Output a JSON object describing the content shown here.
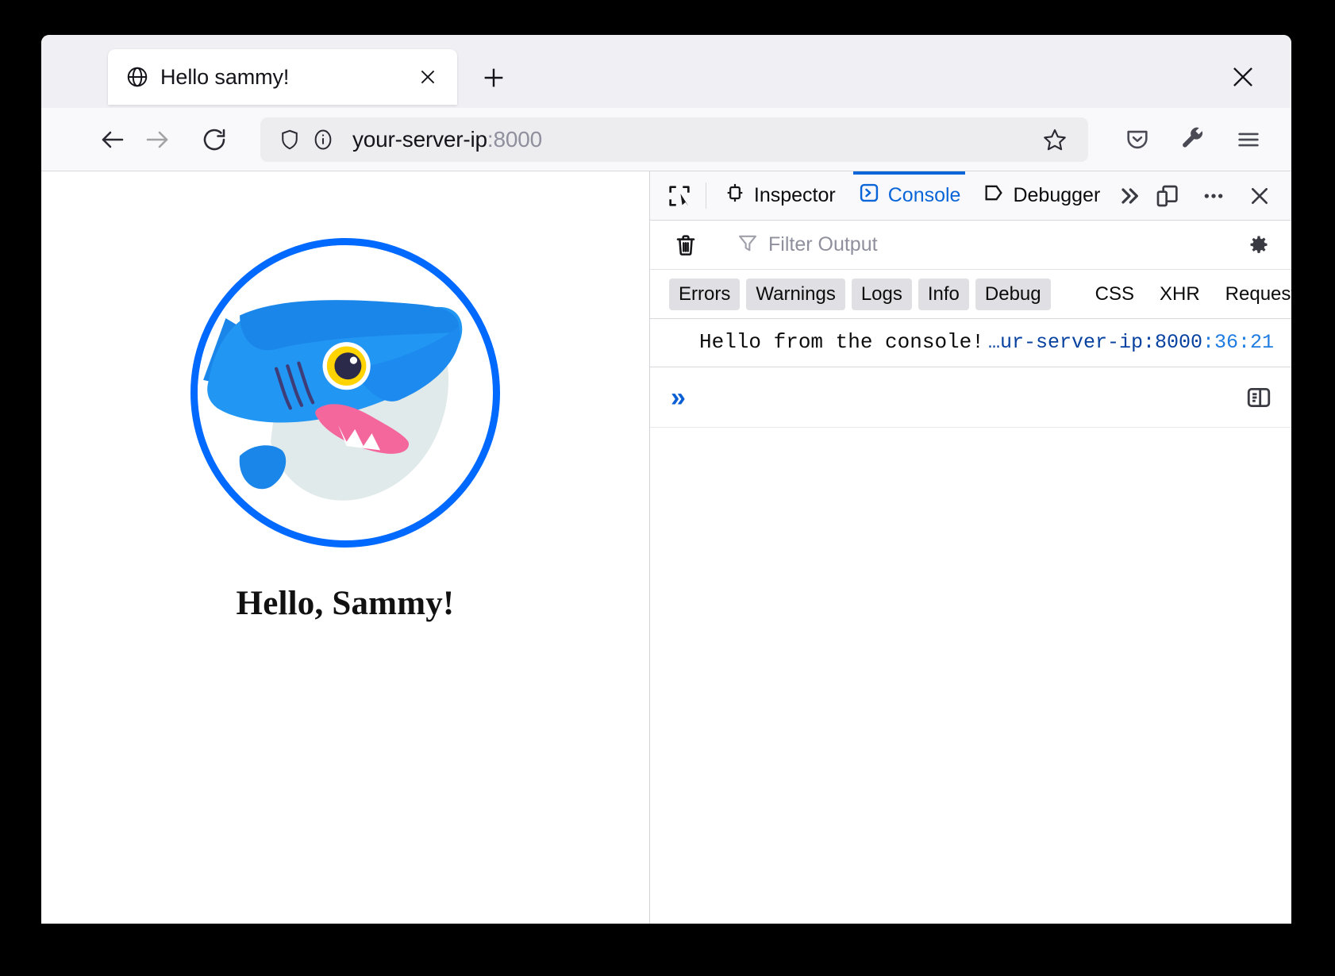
{
  "browser": {
    "tab": {
      "title": "Hello sammy!",
      "favicon": "globe-icon",
      "close": "×"
    },
    "new_tab_label": "+",
    "window_close_label": "×",
    "nav": {
      "back": "back-arrow-icon",
      "forward": "forward-arrow-icon",
      "reload": "reload-icon"
    },
    "urlbar": {
      "shield": "shield-icon",
      "info": "info-circle-icon",
      "host": "your-server-ip",
      "port": ":8000",
      "bookmark": "star-icon"
    },
    "toolbar_icons": [
      "pocket-icon",
      "wrench-icon",
      "hamburger-menu-icon"
    ]
  },
  "page": {
    "heading": "Hello, Sammy!",
    "image_alt": "sammy-shark-logo",
    "colors": {
      "ring": "#0069ff",
      "body_light": "#2196f3",
      "body_dark": "#0d7fe0",
      "belly": "#e1eaea",
      "eye_ring": "#ffd400",
      "pupil": "#2b2a4a",
      "mouth": "#f4679d",
      "gills": "#3f3d78"
    }
  },
  "devtools": {
    "picker_icon": "element-picker-icon",
    "tabs": [
      {
        "label": "Inspector",
        "icon": "inspector-icon",
        "active": false
      },
      {
        "label": "Console",
        "icon": "console-icon",
        "active": true
      },
      {
        "label": "Debugger",
        "icon": "debugger-icon",
        "active": false
      }
    ],
    "overflow_label": "»",
    "responsive_icon": "responsive-design-mode-icon",
    "meatball_label": "•••",
    "close_label": "×",
    "filterbar": {
      "clear_icon": "trash-icon",
      "filter_icon": "funnel-icon",
      "filter_placeholder": "Filter Output",
      "settings_icon": "gear-icon"
    },
    "levels": [
      {
        "label": "Errors",
        "active": true
      },
      {
        "label": "Warnings",
        "active": true
      },
      {
        "label": "Logs",
        "active": true
      },
      {
        "label": "Info",
        "active": true
      },
      {
        "label": "Debug",
        "active": true
      }
    ],
    "filters": [
      {
        "label": "CSS",
        "active": false
      },
      {
        "label": "XHR",
        "active": false
      },
      {
        "label": "Requests",
        "active": false
      }
    ],
    "messages": [
      {
        "text": "Hello from the console!",
        "source": "…ur-server-ip:8000",
        "position": ":36:21"
      }
    ],
    "prompt": "»",
    "editor_icon": "split-console-editor-icon",
    "accent_color": "#0a65d8"
  }
}
